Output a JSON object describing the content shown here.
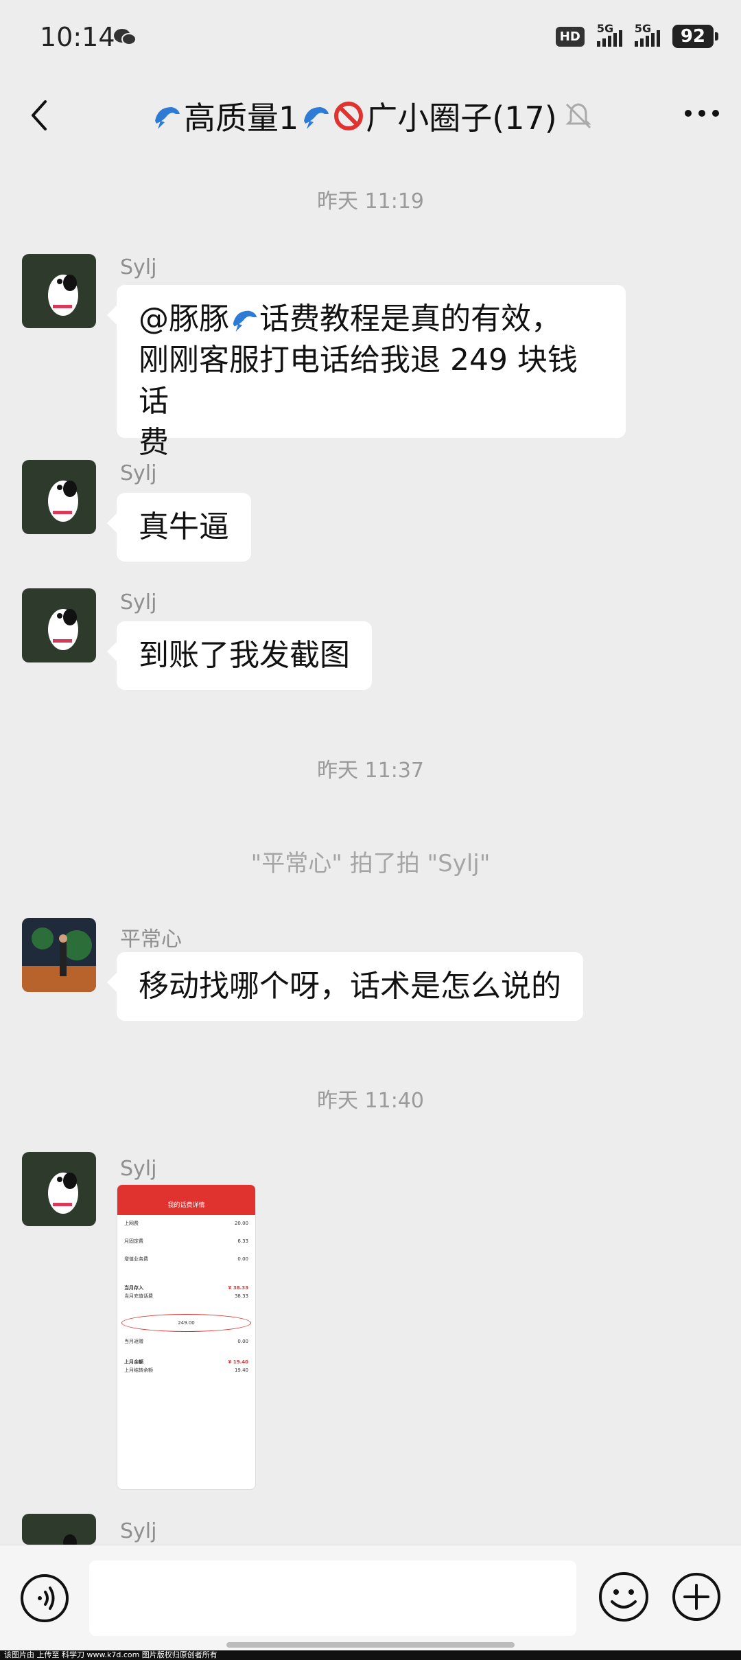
{
  "status": {
    "time": "10:14",
    "hd": "HD",
    "sim1": "5G",
    "sim2": "5G",
    "battery": "92"
  },
  "nav": {
    "title_part1": "高质量1",
    "title_part2": "广小圈子(17)"
  },
  "timestamps": [
    "昨天 11:19",
    "昨天 11:37",
    "昨天 11:40"
  ],
  "system_notice": "\"平常心\" 拍了拍 \"Sylj\"",
  "messages": [
    {
      "sender": "Sylj",
      "line1_prefix": "@豚豚",
      "line1_suffix": " 话费教程是真的有效，",
      "line2": "刚刚客服打电话给我退 249 块钱话",
      "line3": "费"
    },
    {
      "sender": "Sylj",
      "text": "真牛逼"
    },
    {
      "sender": "Sylj",
      "text": "到账了我发截图"
    },
    {
      "sender": "平常心",
      "text": "移动找哪个呀，话术是怎么说的"
    },
    {
      "sender": "Sylj",
      "image": "bill-screenshot"
    },
    {
      "sender": "Sylj"
    }
  ],
  "screenshot": {
    "header": "我的话费详情",
    "rows": [
      {
        "label": "上网费",
        "value": "20.00"
      },
      {
        "label": "月固定费",
        "value": "6.33"
      },
      {
        "label": "增值业务费",
        "value": "0.00"
      }
    ],
    "deposit_label": "当月存入",
    "deposit_value": "¥ 38.33",
    "refund_label": "当月充值话费",
    "refund_value": "38.33",
    "refund_amount": "249.00",
    "bonus_label": "当月返赠",
    "bonus_value": "0.00",
    "balance_label": "上月余额",
    "balance_value": "¥ 19.40",
    "balance_sub_label": "上月结转余额",
    "balance_sub_value": "19.40"
  },
  "watermark": "该图片由 上传至 科学刀 www.k7d.com 图片版权归原创者所有",
  "colors": {
    "bg": "#ededed",
    "bubble": "#ffffff",
    "timestamp": "#9a9a9a",
    "accent_red": "#e0322e"
  }
}
